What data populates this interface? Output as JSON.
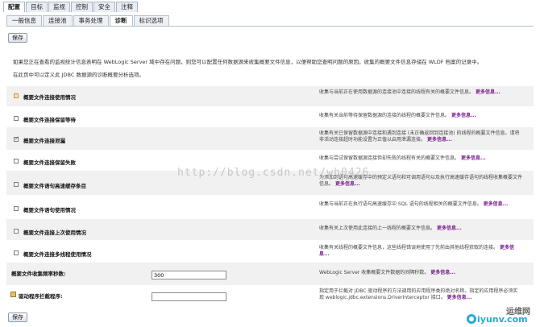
{
  "top_tabs": [
    "配置",
    "目标",
    "监视",
    "控制",
    "安全",
    "注释"
  ],
  "sub_tabs": [
    "一般信息",
    "连接池",
    "事务处理",
    "诊断",
    "标识选项"
  ],
  "save_label": "保存",
  "intro": {
    "line1": "如果您正在查看的监视统计信息表明在 WebLogic Server 域中存在问题，则您可以配置任何数据源来收集概要文件信息，以便帮助您查明问题的原因。收集的概要文件信息存储在 WLDF 档案的记录中。",
    "line2": "在此页中可以定义此 JDBC 数据源的诊断概要分析选项。"
  },
  "more_label": "更多信息...",
  "options": [
    {
      "label": "概要文件连接使用情况",
      "desc": "收集与当前正在使用数据源的连接池中连接的线程有关的概要文件信息。",
      "checked": false
    },
    {
      "label": "概要文件连接保留等待",
      "desc": "收集有关当前等待保留数据源的连接的线程的概要文件信息。",
      "checked": false
    },
    {
      "label": "概要文件连接泄漏",
      "desc": "收集有关已保留数据源中连接和遇到连接 (未正确返回到连接池) 的线程的概要文件信息。请将非活动连接超时功能设置为正值以启用泄漏连接。",
      "checked": true
    },
    {
      "label": "概要文件连接保留失败",
      "desc": "收集与尝试保留数据源连接但却失败的线程有关的概要文件信息。",
      "checked": false
    },
    {
      "label": "概要文件语句高速缓存条目",
      "desc": "为添加到语句高速缓存中的预定义语句和可调用语句以及执行高速缓存语句的线程收集概要文件信息。",
      "checked": false
    },
    {
      "label": "概要文件语句使用情况",
      "desc": "收集与当前正在执行语句高速缓存中 SQL 语句的线程相关的概要文件信息。",
      "checked": false
    },
    {
      "label": "概要文件连接上次使用情况",
      "desc": "收集有关上次使用此连接的上一线程的概要文件信息。",
      "checked": false
    },
    {
      "label": "概要文件连接多线程使用情况",
      "desc": "收集有关线程的概要文件信息，这些线程错误地使用了先前由其他线程获取的连接。",
      "checked": false
    }
  ],
  "harvest": {
    "label": "概要文件收集频率秒数:",
    "value": "300",
    "desc": "WebLogic Server 收集概要文件数据的间隔秒数。"
  },
  "interceptor": {
    "label": "驱动程序拦截程序:",
    "value": "",
    "desc": "指定用于拦截对 JDBC 驱动程序的方法调用的应用程序类的绝对名称。指定的应用程序必须实现 weblogic.jdbc.extensions.DriverInterceptor 接口。"
  },
  "watermark": "http://blog.csdn.net/wh0426",
  "logo": {
    "text": "iyunv.com",
    "cn": "运维网"
  }
}
